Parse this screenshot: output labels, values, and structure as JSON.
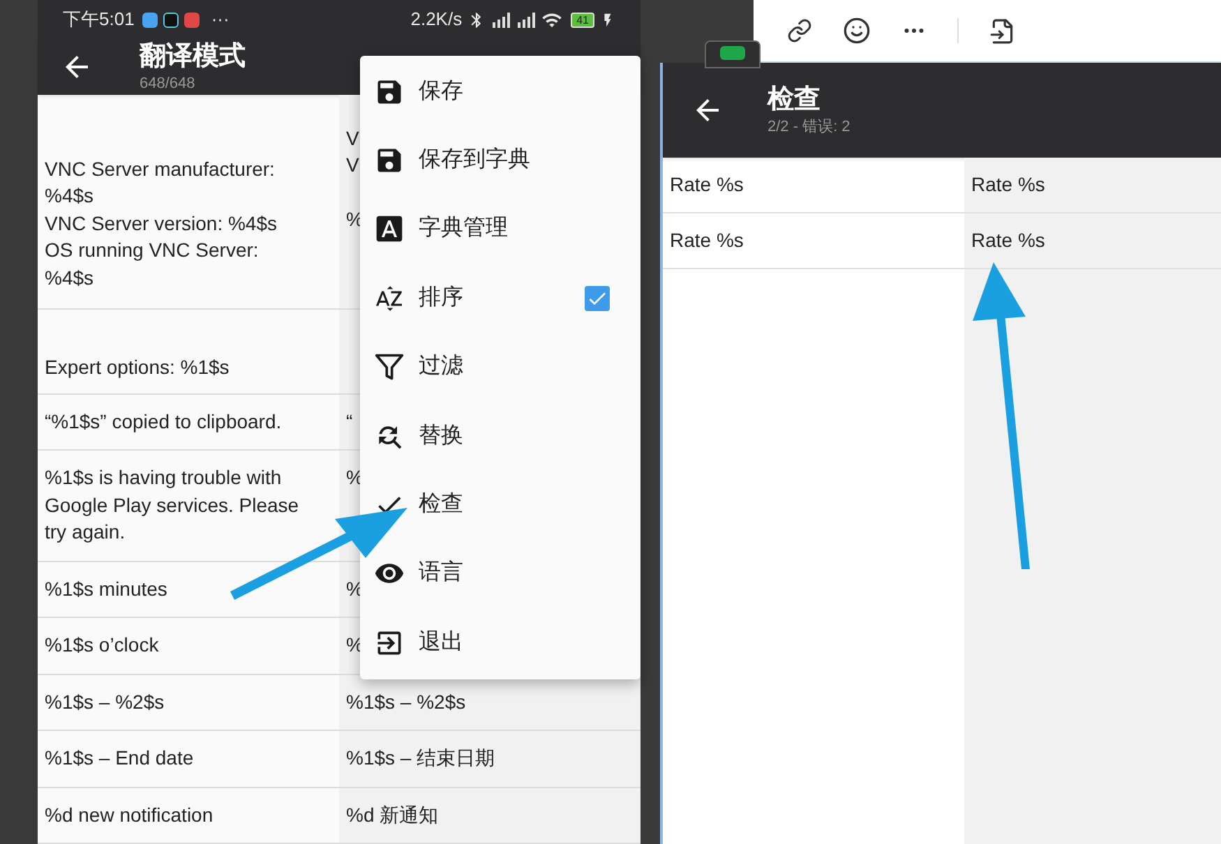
{
  "status_bar": {
    "time": "下午5:01",
    "more": "···",
    "speed": "2.2K/s",
    "battery": "41"
  },
  "left_screen": {
    "title": "翻译模式",
    "subtitle": "648/648",
    "rows": [
      {
        "source": [
          "VNC Server manufacturer: %4$s",
          "VNC Server version: %4$s",
          "OS running VNC Server: %4$s"
        ],
        "translation": [
          "V",
          "V",
          "%"
        ]
      },
      {
        "source": [
          "Expert options: %1$s"
        ],
        "translation": []
      },
      {
        "source": [
          "“%1$s” copied to clipboard."
        ],
        "translation": [
          "“"
        ]
      },
      {
        "source": [
          "%1$s is having trouble with Google Play services. Please try again."
        ],
        "translation": [
          "%"
        ]
      },
      {
        "source": [
          "%1$s minutes"
        ],
        "translation": [
          "%"
        ]
      },
      {
        "source": [
          "%1$s o’clock"
        ],
        "translation": [
          "%"
        ]
      },
      {
        "source": [
          "%1$s  –  %2$s"
        ],
        "translation": [
          "%1$s  –  %2$s"
        ]
      },
      {
        "source": [
          "%1$s  –  End date"
        ],
        "translation": [
          "%1$s  –  结束日期"
        ]
      },
      {
        "source": [
          "%d new notification"
        ],
        "translation": [
          "%d 新通知"
        ]
      }
    ]
  },
  "menu": [
    {
      "label": "保存",
      "kind": "action"
    },
    {
      "label": "保存到字典",
      "kind": "action"
    },
    {
      "label": "字典管理",
      "kind": "action"
    },
    {
      "label": "排序",
      "kind": "check",
      "checked": true
    },
    {
      "label": "过滤",
      "kind": "action"
    },
    {
      "label": "替换",
      "kind": "action"
    },
    {
      "label": "检查",
      "kind": "action"
    },
    {
      "label": "语言",
      "kind": "action"
    },
    {
      "label": "退出",
      "kind": "action"
    }
  ],
  "right_screen": {
    "title": "检查",
    "subtitle": "2/2 - 错误: 2",
    "rows": [
      {
        "source": "Rate %s",
        "translation": "Rate %s"
      },
      {
        "source": "Rate %s",
        "translation": "Rate %s"
      }
    ]
  }
}
